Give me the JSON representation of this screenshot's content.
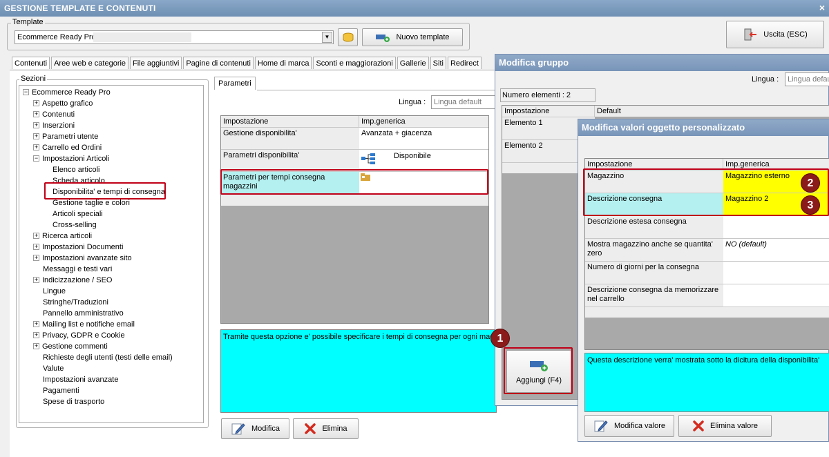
{
  "window": {
    "title": "GESTIONE TEMPLATE E CONTENUTI",
    "close": "×"
  },
  "template": {
    "group_label": "Template",
    "value": "Ecommerce Ready Pro",
    "new_button": "Nuovo template",
    "exit_button": "Uscita (ESC)"
  },
  "tabs": [
    "Contenuti",
    "Aree web e categorie",
    "File aggiuntivi",
    "Pagine di contenuti",
    "Home di marca",
    "Sconti e maggiorazioni",
    "Gallerie",
    "Siti",
    "Redirect"
  ],
  "sections": {
    "label": "Sezioni",
    "items": [
      {
        "label": "Ecommerce Ready Pro",
        "exp": "−"
      },
      {
        "label": "Aspetto grafico",
        "exp": "+"
      },
      {
        "label": "Contenuti",
        "exp": "+"
      },
      {
        "label": "Inserzioni",
        "exp": "+"
      },
      {
        "label": "Parametri utente",
        "exp": "+"
      },
      {
        "label": "Carrello ed Ordini",
        "exp": "+"
      },
      {
        "label": "Impostazioni Articoli",
        "exp": "−"
      },
      {
        "label": "Elenco articoli",
        "exp": ""
      },
      {
        "label": "Scheda articolo",
        "exp": ""
      },
      {
        "label": "Disponibilita' e tempi di consegna",
        "exp": ""
      },
      {
        "label": "Gestione taglie e colori",
        "exp": ""
      },
      {
        "label": "Articoli speciali",
        "exp": ""
      },
      {
        "label": "Cross-selling",
        "exp": ""
      },
      {
        "label": "Ricerca articoli",
        "exp": "+"
      },
      {
        "label": "Impostazioni Documenti",
        "exp": "+"
      },
      {
        "label": "Impostazioni avanzate sito",
        "exp": "+"
      },
      {
        "label": "Messaggi e testi vari",
        "exp": ""
      },
      {
        "label": "Indicizzazione / SEO",
        "exp": "+"
      },
      {
        "label": "Lingue",
        "exp": ""
      },
      {
        "label": "Stringhe/Traduzioni",
        "exp": ""
      },
      {
        "label": "Pannello amministrativo",
        "exp": ""
      },
      {
        "label": "Mailing list e notifiche email",
        "exp": "+"
      },
      {
        "label": "Privacy, GDPR e Cookie",
        "exp": "+"
      },
      {
        "label": "Gestione commenti",
        "exp": "+"
      },
      {
        "label": "Richieste degli utenti (testi delle email)",
        "exp": ""
      },
      {
        "label": "Valute",
        "exp": ""
      },
      {
        "label": "Impostazioni avanzate",
        "exp": ""
      },
      {
        "label": "Pagamenti",
        "exp": ""
      },
      {
        "label": "Spese di trasporto",
        "exp": ""
      }
    ]
  },
  "params": {
    "tab": "Parametri",
    "lingua_label": "Lingua :",
    "lingua_value": "Lingua default",
    "col_setting": "Impostazione",
    "col_value": "Imp.generica",
    "rows": [
      {
        "setting": "Gestione disponibilita'",
        "value": "Avanzata + giacenza"
      },
      {
        "setting": "Parametri disponibilita'",
        "value": "Disponibile"
      },
      {
        "setting": "Parametri per tempi consegna magazzini",
        "value": ""
      }
    ],
    "description": "Tramite questa opzione e' possibile specificare i tempi di consegna per ogni magazzino",
    "modify_button": "Modifica",
    "delete_button": "Elimina"
  },
  "group_dialog": {
    "title": "Modifica gruppo",
    "lingua_label": "Lingua :",
    "lingua_value": "Lingua default",
    "count": "Numero elementi : 2",
    "col_setting": "Impostazione",
    "col_default": "Default",
    "rows": [
      "Elemento 1",
      "Elemento 2"
    ],
    "add_button": "Aggiungi (F4)"
  },
  "object_dialog": {
    "title": "Modifica valori oggetto personalizzato",
    "col_setting": "Impostazione",
    "col_value": "Imp.generica",
    "rows": [
      {
        "setting": "Magazzino",
        "value": "Magazzino esterno"
      },
      {
        "setting": "Descrizione consegna",
        "value": "Magazzino 2"
      },
      {
        "setting": "Descrizione estesa consegna",
        "value": ""
      },
      {
        "setting": "Mostra magazzino anche se quantita' zero",
        "value": "NO (default)"
      },
      {
        "setting": "Numero di giorni per la consegna",
        "value": ""
      },
      {
        "setting": "Descrizione consegna da memorizzare nel carrello",
        "value": ""
      }
    ],
    "description": "Questa descrizione verra' mostrata sotto la dicitura della disponibilita'",
    "modify_button": "Modifica valore",
    "delete_button": "Elimina valore"
  },
  "badges": [
    "1",
    "2",
    "3"
  ],
  "colors": {
    "cyan": "#00ffff",
    "highlight_row": "#b5f0f0",
    "yellow": "#ffff00",
    "annotation_red": "#c00018",
    "badge": "#8b1a1a"
  }
}
